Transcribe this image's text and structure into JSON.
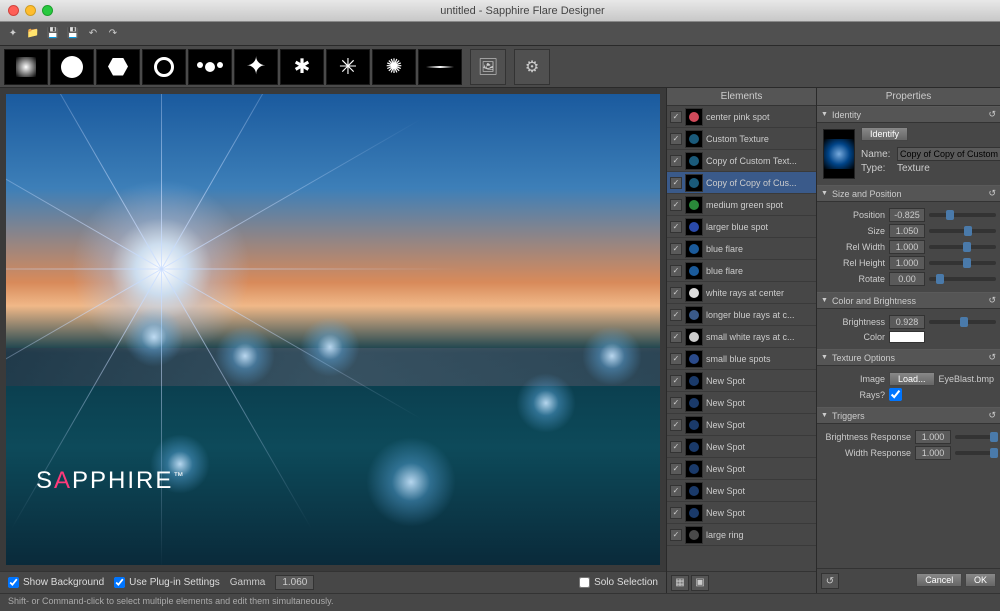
{
  "window": {
    "title": "untitled - Sapphire Flare Designer"
  },
  "elements": {
    "header": "Elements",
    "items": [
      {
        "label": "center pink spot",
        "checked": true,
        "swatch": "#d04a5a",
        "selected": false
      },
      {
        "label": "Custom Texture",
        "checked": true,
        "swatch": "#1a5a7a",
        "selected": false
      },
      {
        "label": "Copy of Custom Text...",
        "checked": true,
        "swatch": "#1a5a7a",
        "selected": false
      },
      {
        "label": "Copy of Copy of Cus...",
        "checked": true,
        "swatch": "#1a5a7a",
        "selected": true
      },
      {
        "label": "medium green spot",
        "checked": true,
        "swatch": "#2a8a3a",
        "selected": false
      },
      {
        "label": "larger blue spot",
        "checked": true,
        "swatch": "#2a4aaa",
        "selected": false
      },
      {
        "label": "blue flare",
        "checked": true,
        "swatch": "#1a5a9a",
        "selected": false
      },
      {
        "label": "blue flare",
        "checked": true,
        "swatch": "#1a5a9a",
        "selected": false
      },
      {
        "label": "white rays at center",
        "checked": true,
        "swatch": "#ddd",
        "selected": false
      },
      {
        "label": "longer blue rays at c...",
        "checked": true,
        "swatch": "#3a5a8a",
        "selected": false
      },
      {
        "label": "small white rays at c...",
        "checked": true,
        "swatch": "#ccc",
        "selected": false
      },
      {
        "label": "small blue spots",
        "checked": true,
        "swatch": "#2a4a8a",
        "selected": false
      },
      {
        "label": "New Spot",
        "checked": true,
        "swatch": "#1a3a6a",
        "selected": false
      },
      {
        "label": "New Spot",
        "checked": true,
        "swatch": "#1a3a6a",
        "selected": false
      },
      {
        "label": "New Spot",
        "checked": true,
        "swatch": "#1a3a6a",
        "selected": false
      },
      {
        "label": "New Spot",
        "checked": true,
        "swatch": "#1a3a6a",
        "selected": false
      },
      {
        "label": "New Spot",
        "checked": true,
        "swatch": "#1a3a6a",
        "selected": false
      },
      {
        "label": "New Spot",
        "checked": true,
        "swatch": "#1a3a6a",
        "selected": false
      },
      {
        "label": "New Spot",
        "checked": true,
        "swatch": "#1a3a6a",
        "selected": false
      },
      {
        "label": "large ring",
        "checked": true,
        "swatch": "#4a4a4a",
        "selected": false
      }
    ]
  },
  "properties": {
    "header": "Properties",
    "identity": {
      "title": "Identity",
      "identify_btn": "Identify",
      "name_label": "Name:",
      "name_value": "Copy of Copy of Custom Te",
      "type_label": "Type:",
      "type_value": "Texture"
    },
    "size_position": {
      "title": "Size and Position",
      "position_label": "Position",
      "position_value": "-0.825",
      "position_pct": 25,
      "size_label": "Size",
      "size_value": "1.050",
      "size_pct": 52,
      "rel_width_label": "Rel Width",
      "rel_width_value": "1.000",
      "rel_width_pct": 50,
      "rel_height_label": "Rel Height",
      "rel_height_value": "1.000",
      "rel_height_pct": 50,
      "rotate_label": "Rotate",
      "rotate_value": "0.00",
      "rotate_pct": 10
    },
    "color_brightness": {
      "title": "Color and Brightness",
      "brightness_label": "Brightness",
      "brightness_value": "0.928",
      "brightness_pct": 46,
      "color_label": "Color",
      "color_value": "#ffffff"
    },
    "texture_options": {
      "title": "Texture Options",
      "image_label": "Image",
      "load_btn": "Load...",
      "image_value": "EyeBlast.bmp",
      "rays_label": "Rays?",
      "rays_checked": true
    },
    "triggers": {
      "title": "Triggers",
      "brightness_resp_label": "Brightness Response",
      "brightness_resp_value": "1.000",
      "brightness_resp_pct": 85,
      "width_resp_label": "Width Response",
      "width_resp_value": "1.000",
      "width_resp_pct": 85
    },
    "cancel_btn": "Cancel",
    "ok_btn": "OK"
  },
  "preview": {
    "show_bg_label": "Show Background",
    "show_bg": true,
    "use_plugin_label": "Use Plug-in Settings",
    "use_plugin": true,
    "gamma_label": "Gamma",
    "gamma_value": "1.060",
    "solo_label": "Solo Selection",
    "solo": false,
    "logo_prefix": "S",
    "logo_a": "A",
    "logo_suffix": "PPHIRE",
    "logo_tm": "™"
  },
  "status": {
    "text": "Shift- or Command-click to select multiple elements and edit them simultaneously."
  }
}
